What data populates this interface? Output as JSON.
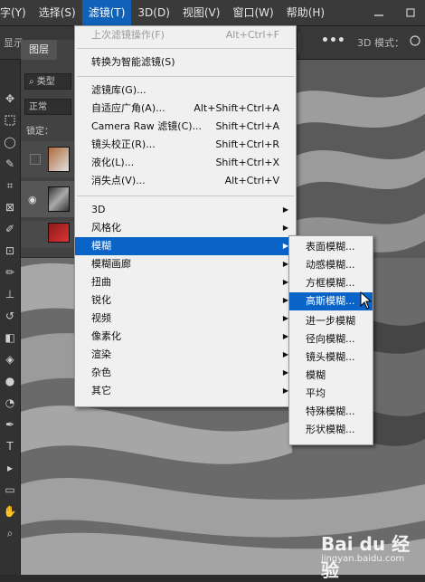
{
  "menubar": {
    "items": [
      "字(Y)",
      "选择(S)",
      "滤镜(T)",
      "3D(D)",
      "视图(V)",
      "窗口(W)",
      "帮助(H)"
    ],
    "active_index": 2
  },
  "optionsbar": {
    "display_label": "显示",
    "mode3d_label": "3D 模式："
  },
  "layers_panel": {
    "tab": "图层",
    "kind_label": "类型",
    "blend_mode": "正常",
    "lock_label": "锁定："
  },
  "filter_menu": {
    "items": [
      {
        "label": "上次滤镜操作(F)",
        "shortcut": "Alt+Ctrl+F",
        "disabled": true
      },
      {
        "label": "转换为智能滤镜(S)",
        "shortcut": ""
      },
      {
        "label": "滤镜库(G)...",
        "shortcut": ""
      },
      {
        "label": "自适应广角(A)...",
        "shortcut": "Alt+Shift+Ctrl+A"
      },
      {
        "label": "Camera Raw 滤镜(C)...",
        "shortcut": "Shift+Ctrl+A"
      },
      {
        "label": "镜头校正(R)...",
        "shortcut": "Shift+Ctrl+R"
      },
      {
        "label": "液化(L)...",
        "shortcut": "Shift+Ctrl+X"
      },
      {
        "label": "消失点(V)...",
        "shortcut": "Alt+Ctrl+V"
      },
      {
        "label": "3D",
        "submenu": true
      },
      {
        "label": "风格化",
        "submenu": true
      },
      {
        "label": "模糊",
        "submenu": true,
        "highlighted": true
      },
      {
        "label": "模糊画廊",
        "submenu": true
      },
      {
        "label": "扭曲",
        "submenu": true
      },
      {
        "label": "锐化",
        "submenu": true
      },
      {
        "label": "视频",
        "submenu": true
      },
      {
        "label": "像素化",
        "submenu": true
      },
      {
        "label": "渲染",
        "submenu": true
      },
      {
        "label": "杂色",
        "submenu": true
      },
      {
        "label": "其它",
        "submenu": true
      }
    ]
  },
  "blur_submenu": {
    "items": [
      "表面模糊...",
      "动感模糊...",
      "方框模糊...",
      "高斯模糊...",
      "进一步模糊",
      "径向模糊...",
      "镜头模糊...",
      "模糊",
      "平均",
      "特殊模糊...",
      "形状模糊..."
    ],
    "highlighted_index": 3
  },
  "watermark": {
    "logo": "Bai du 经验",
    "url": "jingyan.baidu.com"
  },
  "colors": {
    "highlight": "#0a64c8",
    "menu_bg": "#f0f0f0",
    "app_bg": "#2b2b2b"
  }
}
